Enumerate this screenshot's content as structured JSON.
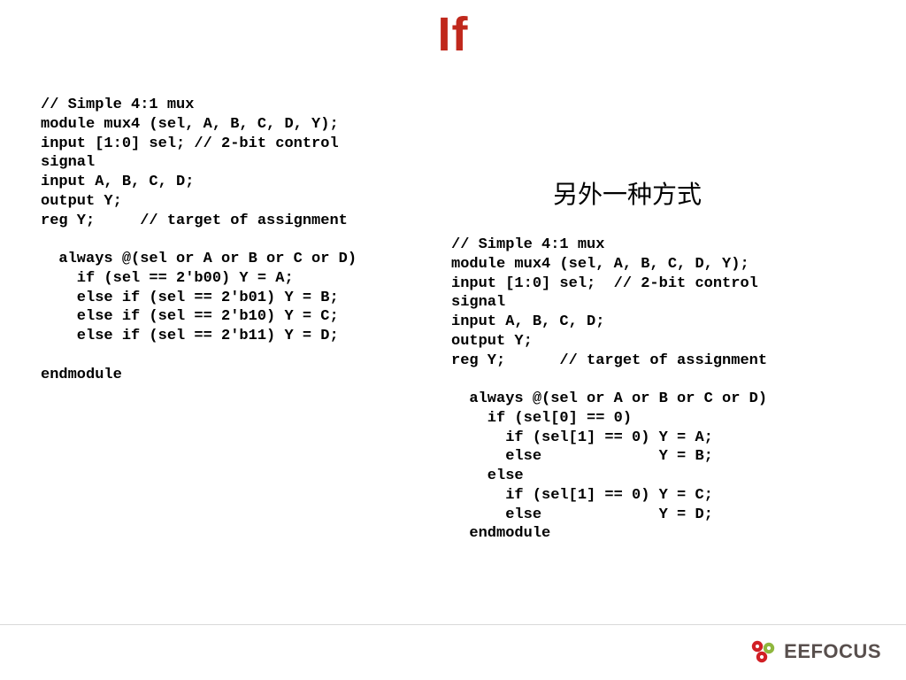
{
  "title": "If",
  "left_code": "// Simple 4:1 mux\nmodule mux4 (sel, A, B, C, D, Y);\ninput [1:0] sel; // 2-bit control\nsignal\ninput A, B, C, D;\noutput Y;\nreg Y;     // target of assignment\n\n  always @(sel or A or B or C or D)\n    if (sel == 2'b00) Y = A;\n    else if (sel == 2'b01) Y = B;\n    else if (sel == 2'b10) Y = C;\n    else if (sel == 2'b11) Y = D;\n\nendmodule",
  "right_heading": "另外一种方式",
  "right_code": "// Simple 4:1 mux\nmodule mux4 (sel, A, B, C, D, Y);\ninput [1:0] sel;  // 2-bit control\nsignal\ninput A, B, C, D;\noutput Y;\nreg Y;      // target of assignment\n\n  always @(sel or A or B or C or D)\n    if (sel[0] == 0)\n      if (sel[1] == 0) Y = A;\n      else             Y = B;\n    else\n      if (sel[1] == 0) Y = C;\n      else             Y = D;\n  endmodule",
  "logo_text": "EEFOCUS",
  "colors": {
    "title": "#c0281c",
    "logo_text": "#584f4d",
    "logo_red": "#d11f25",
    "logo_green": "#8fb73e"
  }
}
